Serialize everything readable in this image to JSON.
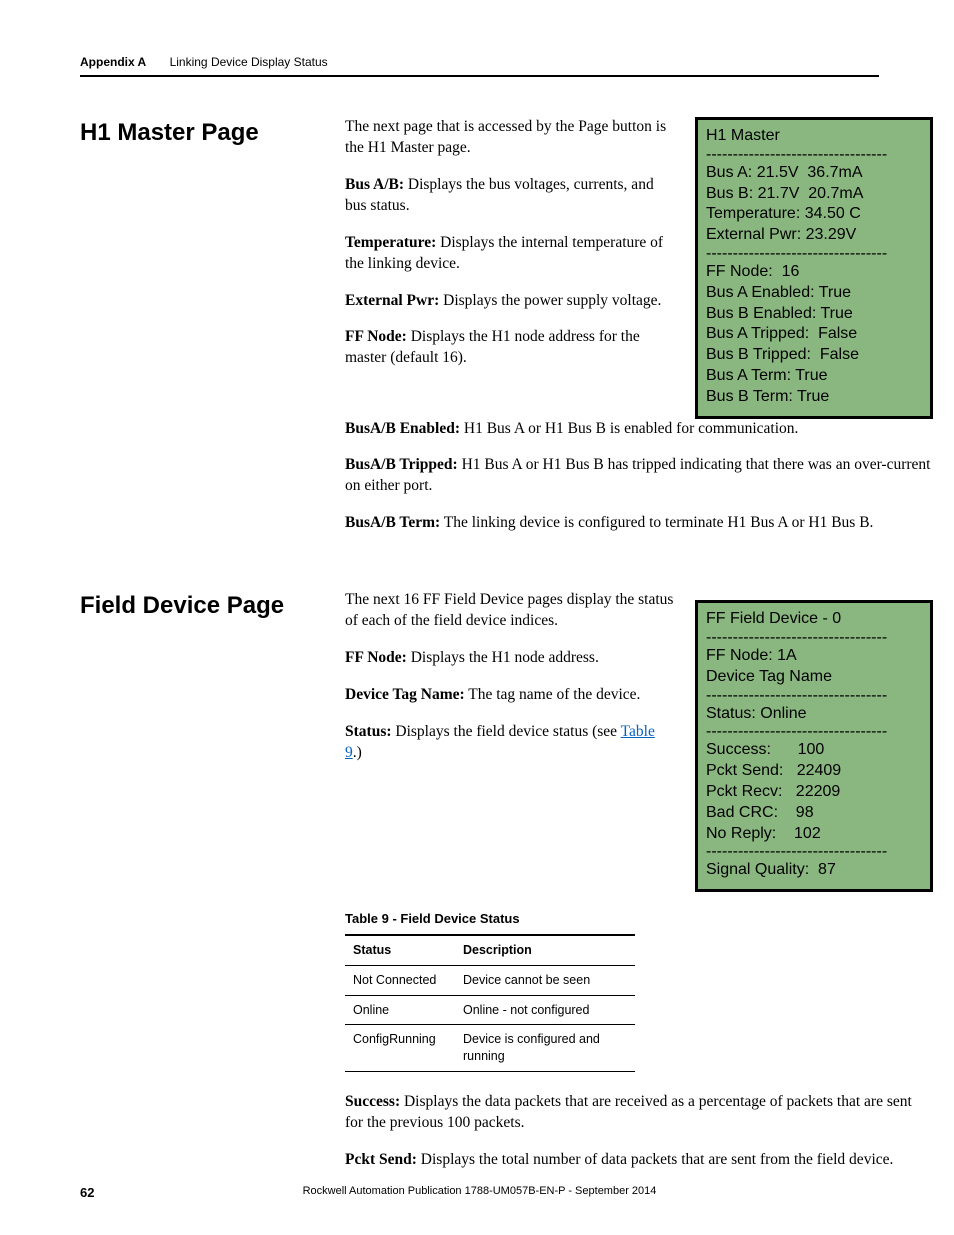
{
  "header": {
    "appendix": "Appendix A",
    "title": "Linking Device Display Status"
  },
  "section1": {
    "heading": "H1 Master Page",
    "intro": "The next page that is accessed by the Page button is the H1 Master page.",
    "busab_label": "Bus A/B:",
    "busab_text": " Displays the bus voltages, currents, and bus status.",
    "temp_label": "Temperature:",
    "temp_text": " Displays the internal temperature of the linking device.",
    "extpwr_label": "External Pwr:",
    "extpwr_text": " Displays the power supply voltage.",
    "ffnode_label": "FF Node:",
    "ffnode_text": " Displays the H1 node address for the master (default 16).",
    "busenabled_label": "BusA/B Enabled:",
    "busenabled_text": " H1 Bus A or H1 Bus B is enabled for communication.",
    "bustripped_label": "BusA/B Tripped:",
    "bustripped_text": " H1 Bus A or H1 Bus B has tripped indicating that there was an over-current on either port.",
    "busterm_label": "BusA/B Term:",
    "busterm_text": " The linking device is configured to terminate H1 Bus A or H1 Bus B."
  },
  "lcd1": {
    "title": "H1 Master",
    "dashes": "----------------------------------",
    "bus_a": "Bus A: 21.5V  36.7mA",
    "bus_b": "Bus B: 21.7V  20.7mA",
    "temperature": "Temperature: 34.50 C",
    "ext_pwr": "External Pwr: 23.29V",
    "ff_node": "FF Node:  16",
    "bus_a_enabled": "Bus A Enabled: True",
    "bus_b_enabled": "Bus B Enabled: True",
    "bus_a_tripped": "Bus A Tripped:  False",
    "bus_b_tripped": "Bus B Tripped:  False",
    "bus_a_term": "Bus A Term: True",
    "bus_b_term": "Bus B Term: True"
  },
  "section2": {
    "heading": "Field Device Page",
    "intro": "The next 16 FF Field Device pages display the status of each of the field device indices.",
    "ffnode_label": "FF Node:",
    "ffnode_text": " Displays the H1 node address.",
    "tagname_label": "Device Tag Name:",
    "tagname_text": " The tag name of the device.",
    "status_label": "Status:",
    "status_text": " Displays the field device status (see ",
    "status_link_text": "Table 9",
    "status_after_link": ".)",
    "table_caption": "Table 9 - Field Device Status",
    "table": {
      "col_status": "Status",
      "col_desc": "Description",
      "rows": [
        {
          "status": "Not Connected",
          "desc": "Device cannot be seen"
        },
        {
          "status": "Online",
          "desc": "Online - not configured"
        },
        {
          "status": "ConfigRunning",
          "desc": "Device is configured and running"
        }
      ]
    },
    "success_label": "Success:",
    "success_text": " Displays the data packets that are received as a percentage of packets that are sent for the previous 100 packets.",
    "pktsend_label": "Pckt Send:",
    "pktsend_text": " Displays the total number of data packets that are sent from the field device."
  },
  "lcd2": {
    "title": "FF Field Device - 0",
    "dashes": "----------------------------------",
    "ff_node": "FF Node: 1A",
    "device_tag": "Device Tag Name",
    "status": "Status: Online",
    "success": "Success:      100",
    "pckt_send": "Pckt Send:   22409",
    "pckt_recv": "Pckt Recv:   22209",
    "bad_crc": "Bad CRC:    98",
    "no_reply": "No Reply:    102",
    "sig_qual": "Signal Quality:  87"
  },
  "footer": {
    "page": "62",
    "pub": "Rockwell Automation Publication 1788-UM057B-EN-P - September 2014"
  }
}
